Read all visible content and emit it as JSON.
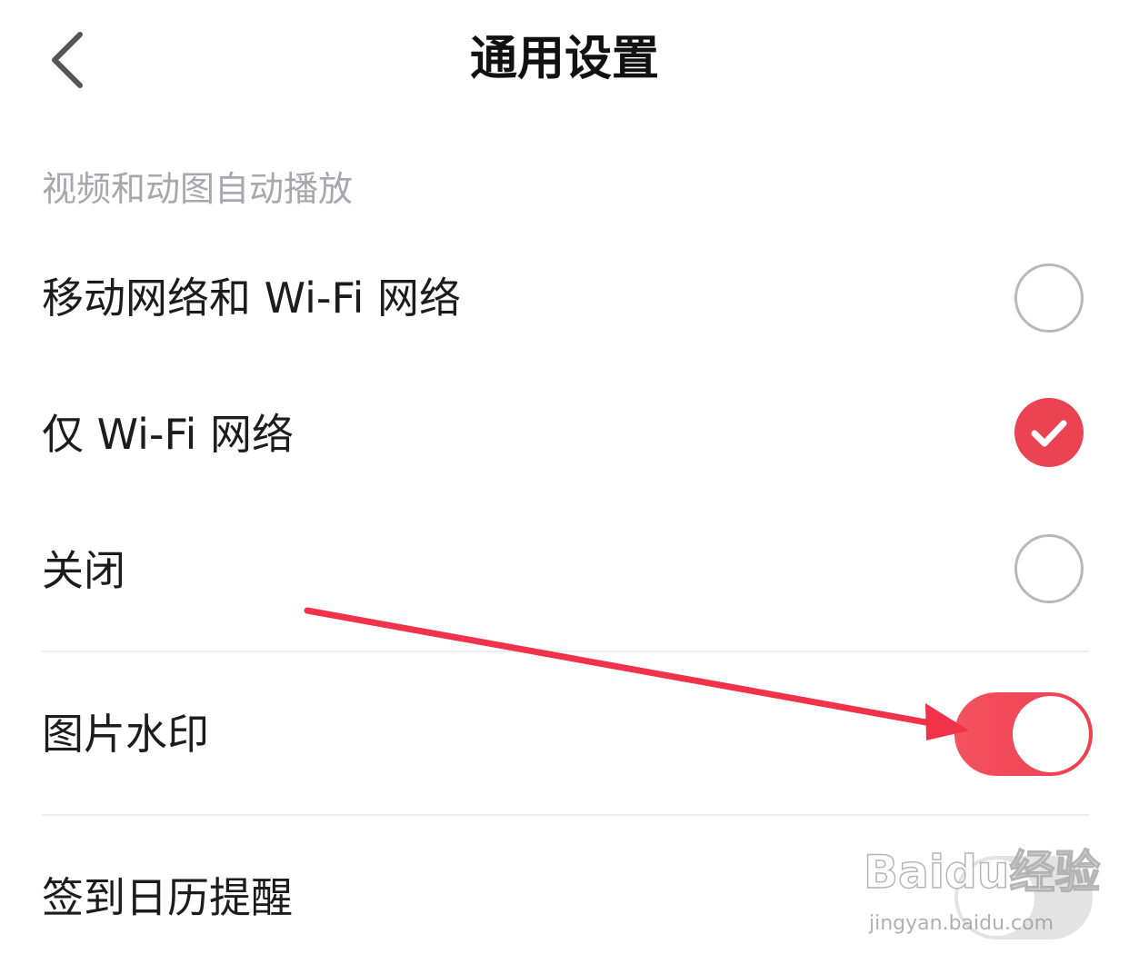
{
  "header": {
    "title": "通用设置",
    "back_icon": "chevron-left-icon"
  },
  "autoplay": {
    "section_label": "视频和动图自动播放",
    "options": [
      {
        "label": "移动网络和 Wi-Fi 网络",
        "selected": false
      },
      {
        "label": "仅 Wi-Fi 网络",
        "selected": true
      },
      {
        "label": "关闭",
        "selected": false
      }
    ]
  },
  "toggles": {
    "watermark": {
      "label": "图片水印",
      "on": true
    },
    "checkin_reminder": {
      "label": "签到日历提醒",
      "on": false
    }
  },
  "overlay": {
    "watermark_text": "Baidu经验",
    "watermark_url": "jingyan.baidu.com"
  },
  "colors": {
    "accent": "#ec4352",
    "annotation_arrow": "#f0334a",
    "section_label": "#a7a7ad",
    "radio_border": "#b8b8b8"
  }
}
